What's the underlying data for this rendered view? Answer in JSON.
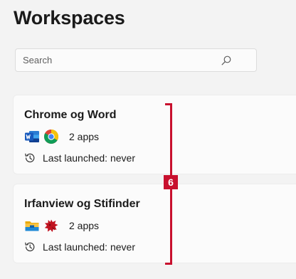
{
  "header": {
    "title": "Workspaces"
  },
  "search": {
    "placeholder": "Search",
    "value": ""
  },
  "workspaces": [
    {
      "name": "Chrome og Word",
      "apps": [
        "word-icon",
        "chrome-icon"
      ],
      "apps_count": "2 apps",
      "last_launched": "Last launched: never"
    },
    {
      "name": "Irfanview og Stifinder",
      "apps": [
        "file-explorer-icon",
        "irfanview-icon"
      ],
      "apps_count": "2 apps",
      "last_launched": "Last launched: never"
    }
  ],
  "annotation": {
    "badge": "6",
    "color": "#c8102e"
  },
  "colors": {
    "background": "#f3f3f3",
    "card": "#fbfbfb",
    "word_blue": "#185abd",
    "chrome_red": "#db4437",
    "chrome_yellow": "#f4c20d",
    "chrome_green": "#0f9d58",
    "chrome_blue": "#4285f4",
    "explorer_yellow": "#f8c341",
    "irfanview_red": "#c1121f"
  }
}
